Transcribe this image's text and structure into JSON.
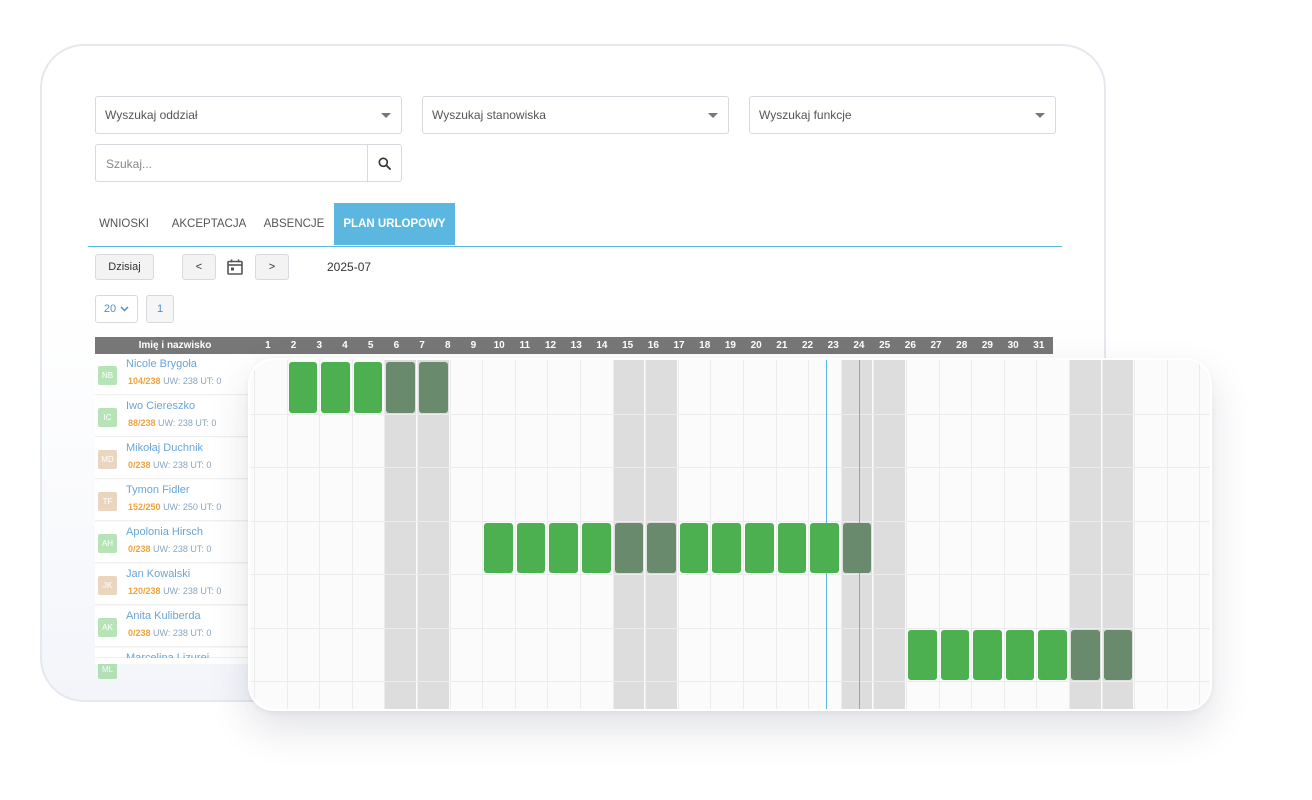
{
  "filters": {
    "department": "Wyszukaj oddział",
    "position": "Wyszukaj stanowiska",
    "function": "Wyszukaj funkcje",
    "search_placeholder": "Szukaj..."
  },
  "tabs": [
    {
      "label": "WNIOSKI"
    },
    {
      "label": "AKCEPTACJA"
    },
    {
      "label": "ABSENCJE"
    },
    {
      "label": "PLAN URLOPOWY"
    }
  ],
  "toolbar": {
    "today": "Dzisiaj",
    "prev": "<",
    "next": ">",
    "month": "2025-07",
    "page_size": "20",
    "page": "1"
  },
  "grid": {
    "name_header": "Imię i nazwisko",
    "days": [
      "1",
      "2",
      "3",
      "4",
      "5",
      "6",
      "7",
      "8",
      "9",
      "10",
      "11",
      "12",
      "13",
      "14",
      "15",
      "16",
      "17",
      "18",
      "19",
      "20",
      "21",
      "22",
      "23",
      "24",
      "25",
      "26",
      "27",
      "28",
      "29",
      "30",
      "31"
    ]
  },
  "employees": [
    {
      "initials": "NB",
      "name": "Nicole Brygoła",
      "used": "104/238",
      "rest": "UW: 238 UT: 0",
      "avatar_color": "#7ccf7c"
    },
    {
      "initials": "IC",
      "name": "Iwo Ciereszko",
      "used": "88/238",
      "rest": "UW: 238 UT: 0",
      "avatar_color": "#7ccf7c"
    },
    {
      "initials": "MD",
      "name": "Mikołaj Duchnik",
      "used": "0/238",
      "rest": "UW: 238 UT: 0",
      "avatar_color": "#d9b48a"
    },
    {
      "initials": "TF",
      "name": "Tymon Fidler",
      "used": "152/250",
      "rest": "UW: 250 UT: 0",
      "avatar_color": "#d9b48a"
    },
    {
      "initials": "AH",
      "name": "Apolonia Hirsch",
      "used": "0/238",
      "rest": "UW: 238 UT: 0",
      "avatar_color": "#7ccf7c"
    },
    {
      "initials": "JK",
      "name": "Jan Kowalski",
      "used": "120/238",
      "rest": "UW: 238 UT: 0",
      "avatar_color": "#d9b48a"
    },
    {
      "initials": "AK",
      "name": "Anita Kuliberda",
      "used": "0/238",
      "rest": "UW: 238 UT: 0",
      "avatar_color": "#7ccf7c"
    },
    {
      "initials": "ML",
      "name": "Marcelina Lizurej",
      "used": "",
      "rest": "",
      "avatar_color": "#7ccf7c"
    }
  ],
  "colors": {
    "accent": "#5bb7e0",
    "leave_workday": "#4caf50",
    "leave_weekend": "#6a8a6e",
    "weekend_cell": "#dddddd"
  }
}
